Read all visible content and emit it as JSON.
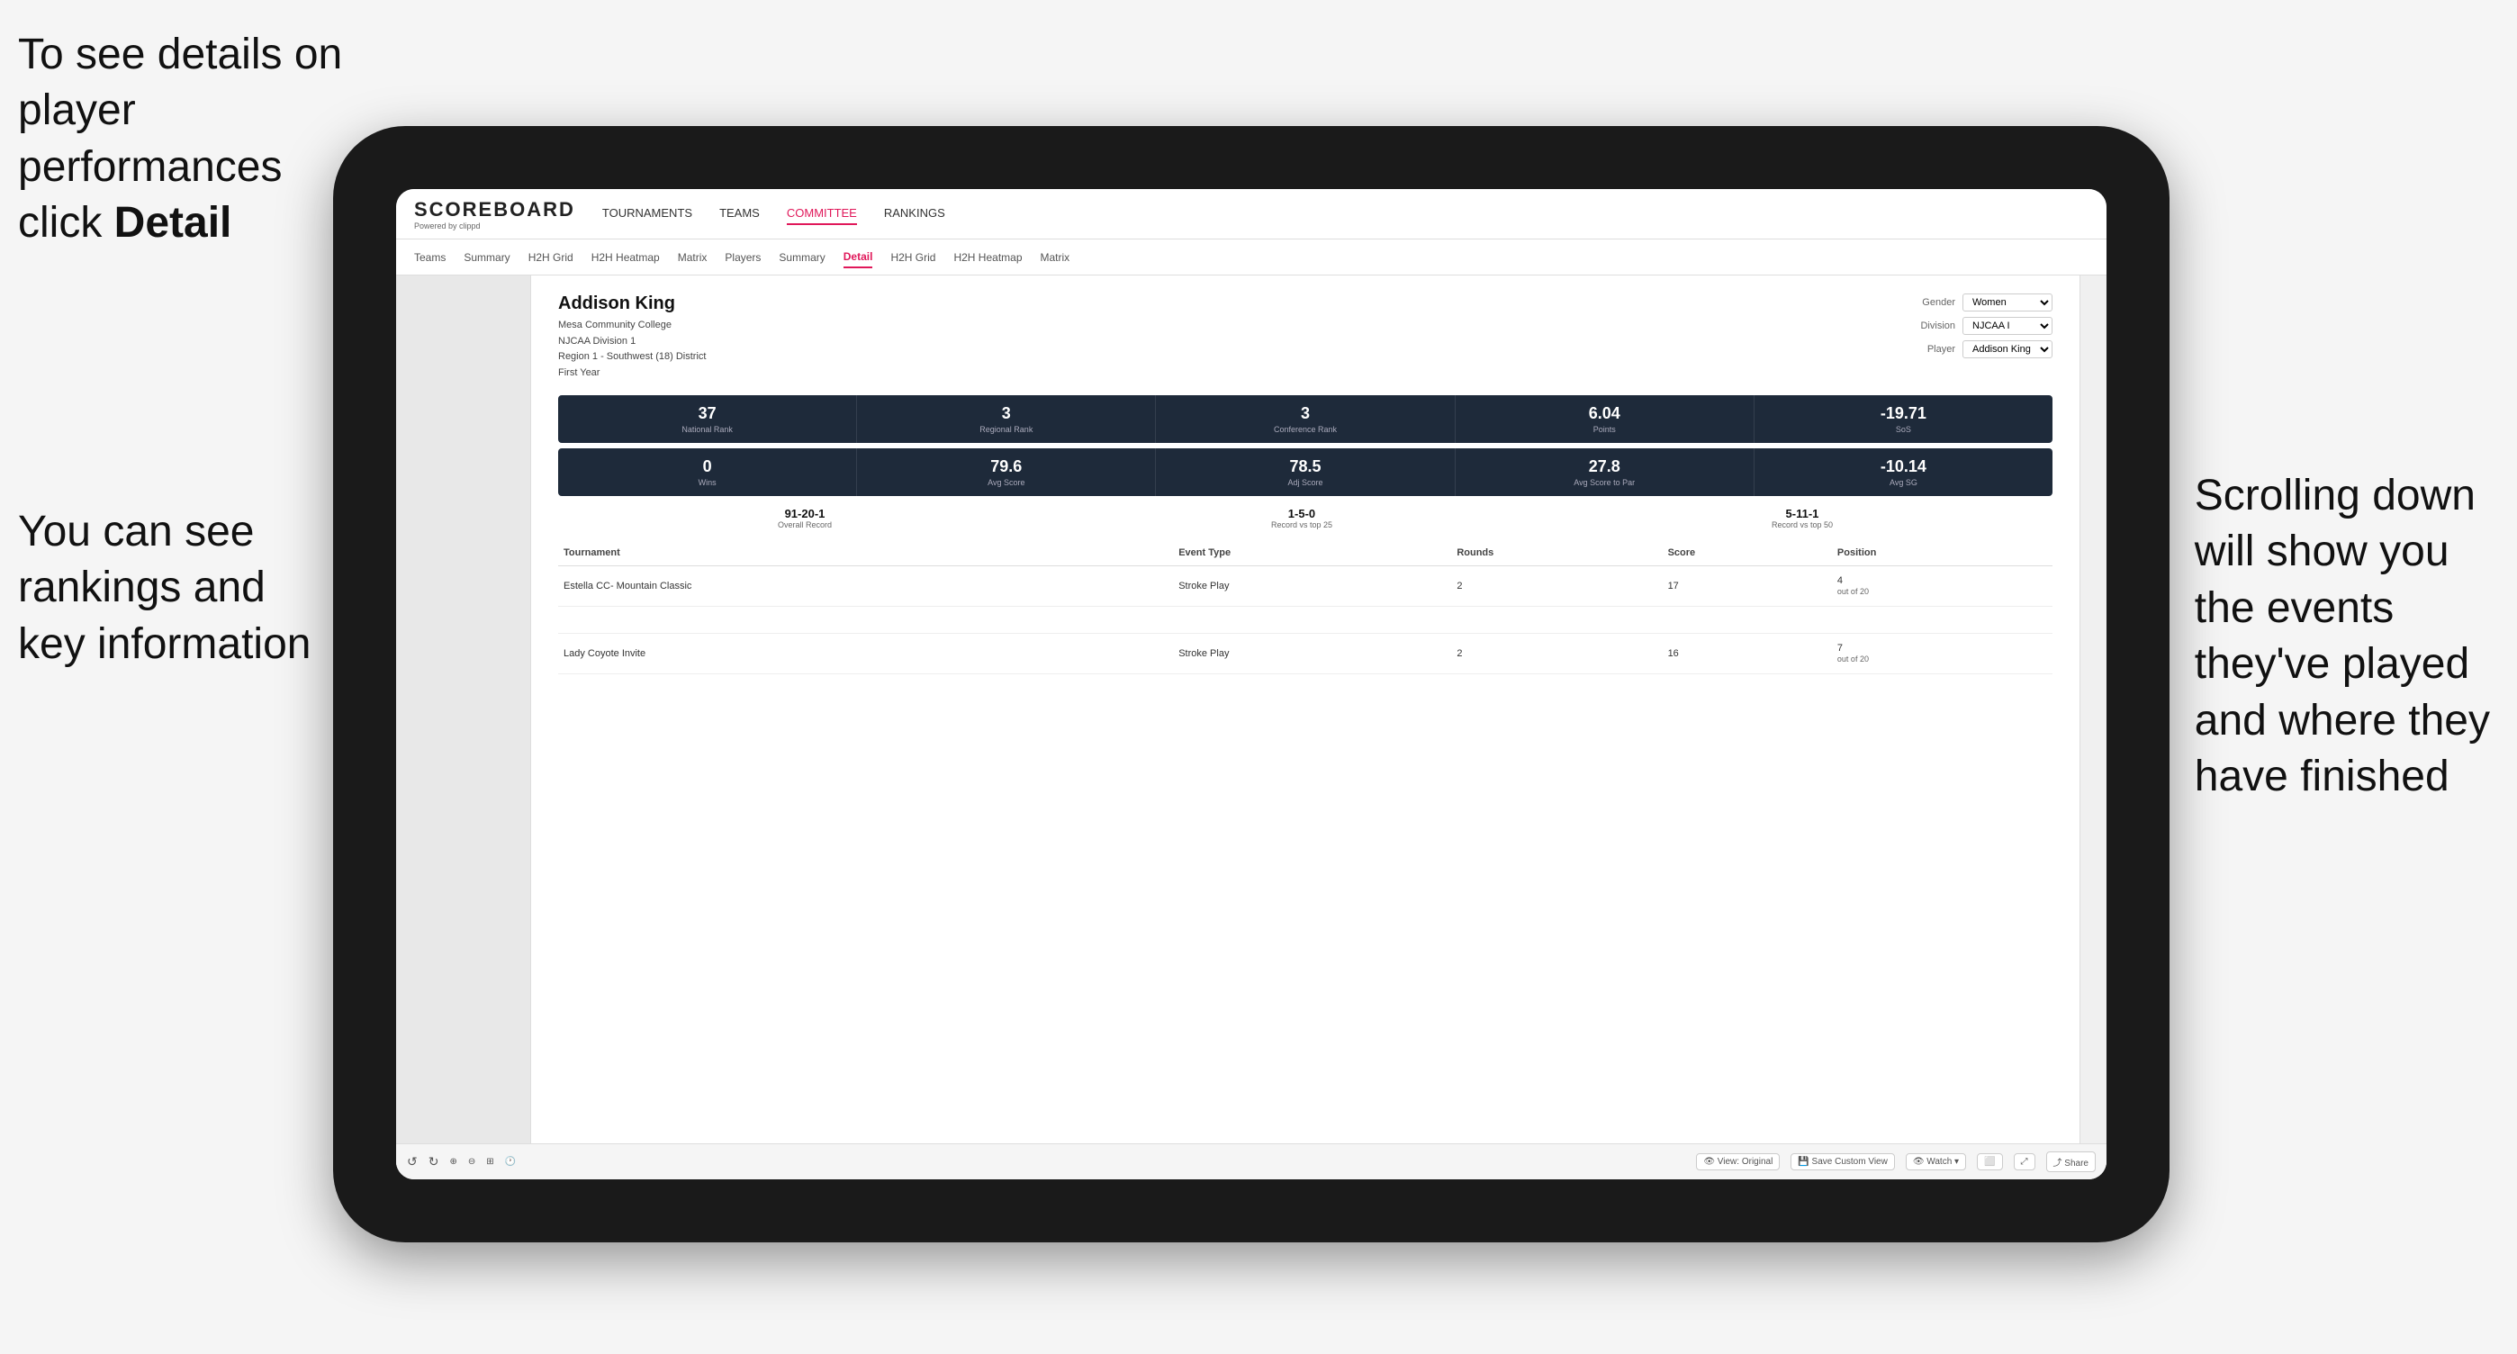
{
  "annotations": {
    "top_left": {
      "line1": "To see details on",
      "line2": "player performances",
      "line3_prefix": "click ",
      "line3_bold": "Detail"
    },
    "bottom_left": {
      "line1": "You can see",
      "line2": "rankings and",
      "line3": "key information"
    },
    "right": {
      "line1": "Scrolling down",
      "line2": "will show you",
      "line3": "the events",
      "line4": "they've played",
      "line5": "and where they",
      "line6": "have finished"
    }
  },
  "app": {
    "logo": "SCOREBOARD",
    "logo_sub": "Powered by clippd",
    "nav_items": [
      {
        "label": "TOURNAMENTS",
        "active": false
      },
      {
        "label": "TEAMS",
        "active": false
      },
      {
        "label": "COMMITTEE",
        "active": true
      },
      {
        "label": "RANKINGS",
        "active": false
      }
    ],
    "sub_nav": [
      {
        "label": "Teams",
        "active": false
      },
      {
        "label": "Summary",
        "active": false
      },
      {
        "label": "H2H Grid",
        "active": false
      },
      {
        "label": "H2H Heatmap",
        "active": false
      },
      {
        "label": "Matrix",
        "active": false
      },
      {
        "label": "Players",
        "active": false
      },
      {
        "label": "Summary",
        "active": false
      },
      {
        "label": "Detail",
        "active": true
      },
      {
        "label": "H2H Grid",
        "active": false
      },
      {
        "label": "H2H Heatmap",
        "active": false
      },
      {
        "label": "Matrix",
        "active": false
      }
    ]
  },
  "player": {
    "name": "Addison King",
    "school": "Mesa Community College",
    "division": "NJCAA Division 1",
    "region": "Region 1 - Southwest (18) District",
    "year": "First Year"
  },
  "controls": {
    "gender_label": "Gender",
    "gender_value": "Women",
    "division_label": "Division",
    "division_value": "NJCAA I",
    "player_label": "Player",
    "player_value": "Addison King"
  },
  "stats_row1": [
    {
      "value": "37",
      "label": "National Rank"
    },
    {
      "value": "3",
      "label": "Regional Rank"
    },
    {
      "value": "3",
      "label": "Conference Rank"
    },
    {
      "value": "6.04",
      "label": "Points"
    },
    {
      "value": "-19.71",
      "label": "SoS"
    }
  ],
  "stats_row2": [
    {
      "value": "0",
      "label": "Wins"
    },
    {
      "value": "79.6",
      "label": "Avg Score"
    },
    {
      "value": "78.5",
      "label": "Adj Score"
    },
    {
      "value": "27.8",
      "label": "Avg Score to Par"
    },
    {
      "value": "-10.14",
      "label": "Avg SG"
    }
  ],
  "records": [
    {
      "value": "91-20-1",
      "label": "Overall Record"
    },
    {
      "value": "1-5-0",
      "label": "Record vs top 25"
    },
    {
      "value": "5-11-1",
      "label": "Record vs top 50"
    }
  ],
  "table": {
    "headers": [
      "Tournament",
      "Event Type",
      "Rounds",
      "Score",
      "Position"
    ],
    "rows": [
      {
        "tournament": "Estella CC- Mountain Classic",
        "event_type": "Stroke Play",
        "rounds": "2",
        "score": "17",
        "position": "4\nout of 20"
      },
      {
        "tournament": "",
        "event_type": "",
        "rounds": "",
        "score": "",
        "position": ""
      },
      {
        "tournament": "Lady Coyote Invite",
        "event_type": "Stroke Play",
        "rounds": "2",
        "score": "16",
        "position": "7\nout of 20"
      }
    ]
  },
  "toolbar": {
    "undo": "↺",
    "redo": "↻",
    "view_original": "View: Original",
    "save_custom": "Save Custom View",
    "watch": "Watch",
    "share": "Share"
  }
}
